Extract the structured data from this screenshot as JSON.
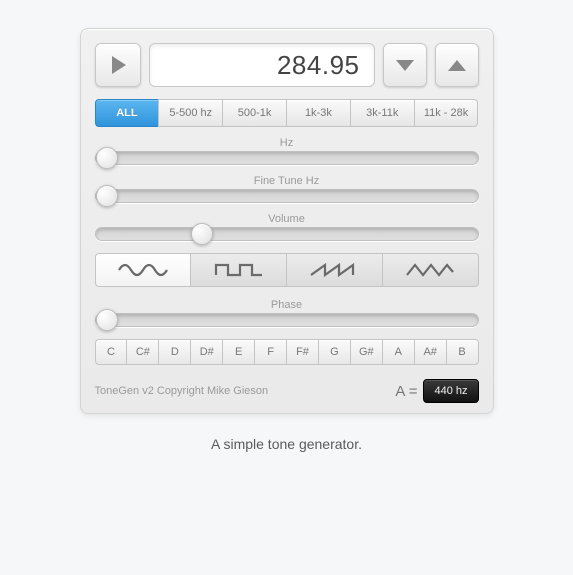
{
  "frequency_display": "284.95",
  "ranges": [
    {
      "label": "ALL",
      "active": true
    },
    {
      "label": "5-500 hz",
      "active": false
    },
    {
      "label": "500-1k",
      "active": false
    },
    {
      "label": "1k-3k",
      "active": false
    },
    {
      "label": "3k-11k",
      "active": false
    },
    {
      "label": "11k - 28k",
      "active": false
    }
  ],
  "sliders": {
    "hz": {
      "label": "Hz",
      "position_pct": 3
    },
    "fine": {
      "label": "Fine Tune Hz",
      "position_pct": 3
    },
    "volume": {
      "label": "Volume",
      "position_pct": 28
    },
    "phase": {
      "label": "Phase",
      "position_pct": 3
    }
  },
  "waveforms": [
    {
      "name": "sine",
      "active": true
    },
    {
      "name": "square",
      "active": false
    },
    {
      "name": "sawtooth",
      "active": false
    },
    {
      "name": "triangle",
      "active": false
    }
  ],
  "notes": [
    "C",
    "C#",
    "D",
    "D#",
    "E",
    "F",
    "F#",
    "G",
    "G#",
    "A",
    "A#",
    "B"
  ],
  "copyright": "ToneGen v2 Copyright Mike Gieson",
  "a_eq_label": "A =",
  "a_eq_value": "440 hz",
  "caption": "A simple tone generator."
}
